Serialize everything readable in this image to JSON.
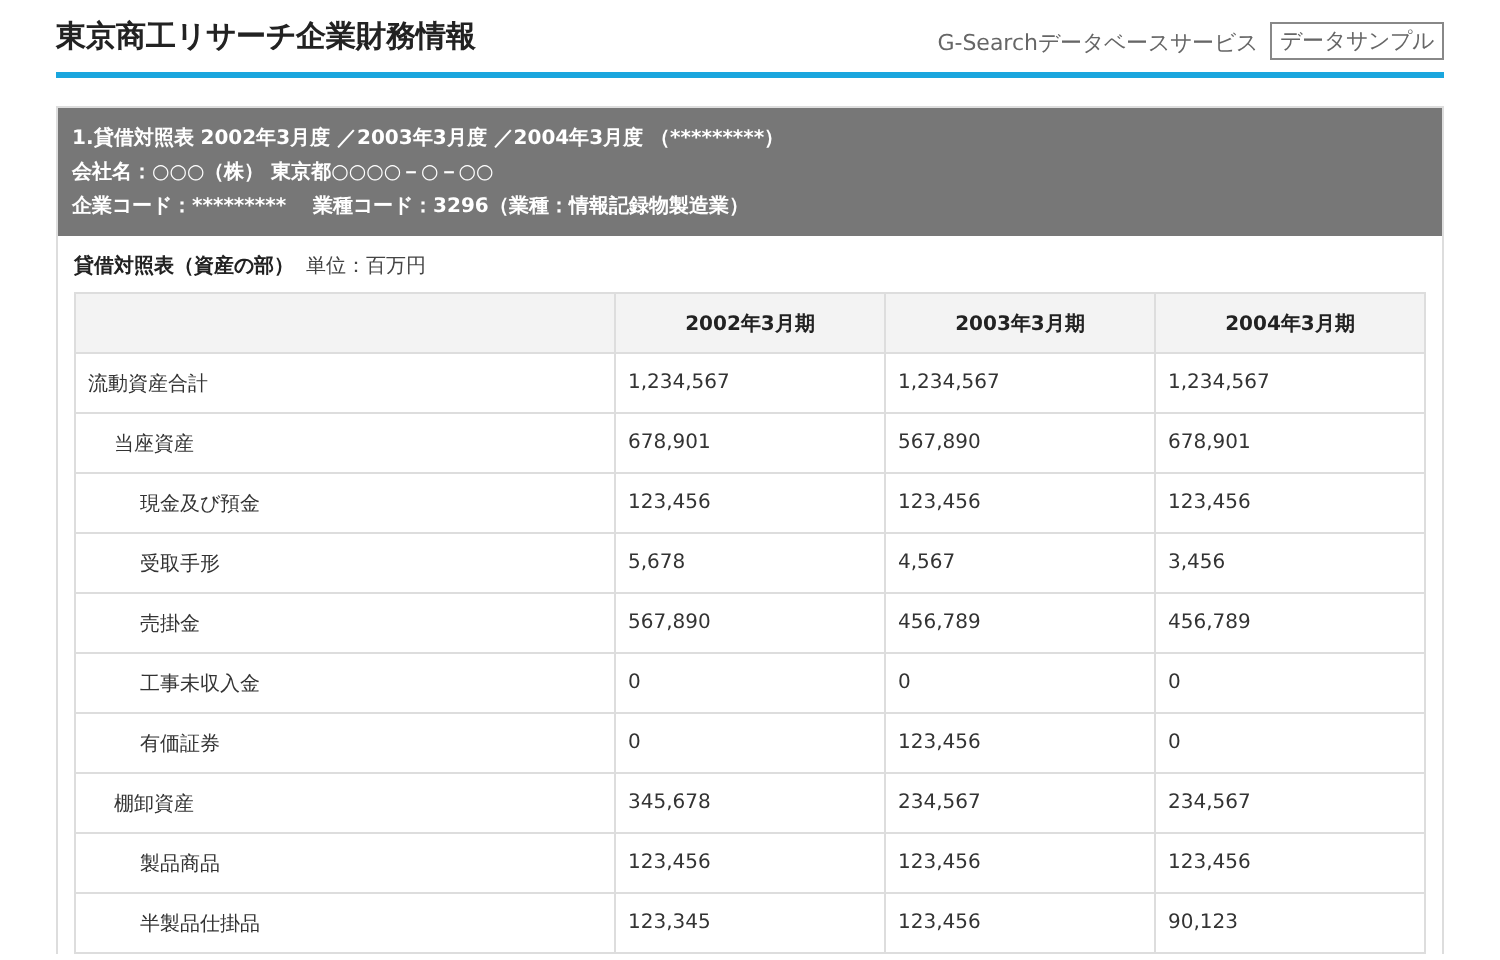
{
  "header": {
    "title": "東京商工リサーチ企業財務情報",
    "service": "G-Searchデータベースサービス",
    "badge": "データサンプル"
  },
  "info": [
    "1.貸借対照表 2002年3月度 ／2003年3月度 ／2004年3月度 （*********）",
    "会社名：○○○（株） 東京都○○○○－○－○○",
    "企業コード：*********　 業種コード：3296（業種：情報記録物製造業）"
  ],
  "section": {
    "title": "貸借対照表（資産の部）",
    "unit": "単位：百万円"
  },
  "table": {
    "columns": [
      "2002年3月期",
      "2003年3月期",
      "2004年3月期"
    ],
    "rows": [
      {
        "label": "流動資産合計",
        "values": [
          "1,234,567",
          "1,234,567",
          "1,234,567"
        ],
        "children": [
          {
            "label": "当座資産",
            "values": [
              "678,901",
              "567,890",
              "678,901"
            ],
            "children": [
              {
                "label": "現金及び預金",
                "values": [
                  "123,456",
                  "123,456",
                  "123,456"
                ]
              },
              {
                "label": "受取手形",
                "values": [
                  "5,678",
                  "4,567",
                  "3,456"
                ]
              },
              {
                "label": "売掛金",
                "values": [
                  "567,890",
                  "456,789",
                  "456,789"
                ]
              },
              {
                "label": "工事未収入金",
                "values": [
                  "0",
                  "0",
                  "0"
                ]
              },
              {
                "label": "有価証券",
                "values": [
                  "0",
                  "123,456",
                  "0"
                ]
              }
            ]
          },
          {
            "label": "棚卸資産",
            "values": [
              "345,678",
              "234,567",
              "234,567"
            ],
            "children": [
              {
                "label": "製品商品",
                "values": [
                  "123,456",
                  "123,456",
                  "123,456"
                ]
              },
              {
                "label": "半製品仕掛品",
                "values": [
                  "123,345",
                  "123,456",
                  "90,123"
                ]
              }
            ]
          }
        ]
      }
    ]
  }
}
